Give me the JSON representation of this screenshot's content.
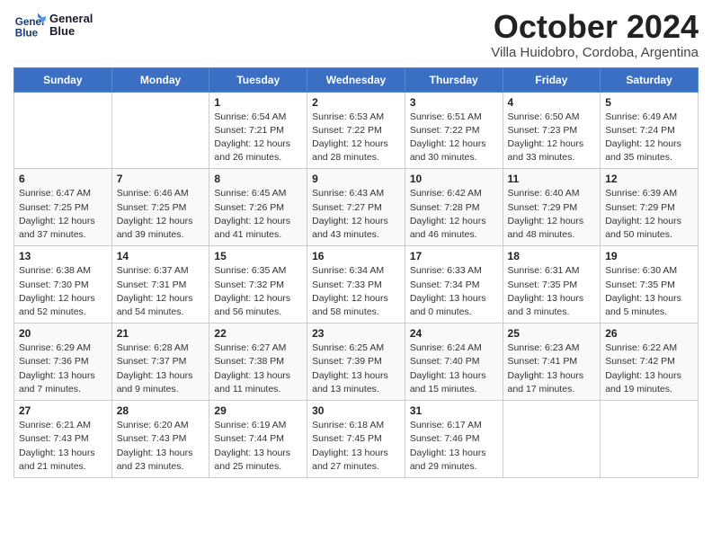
{
  "header": {
    "logo_line1": "General",
    "logo_line2": "Blue",
    "month": "October 2024",
    "location": "Villa Huidobro, Cordoba, Argentina"
  },
  "days_of_week": [
    "Sunday",
    "Monday",
    "Tuesday",
    "Wednesday",
    "Thursday",
    "Friday",
    "Saturday"
  ],
  "weeks": [
    [
      {
        "day": "",
        "content": ""
      },
      {
        "day": "",
        "content": ""
      },
      {
        "day": "1",
        "content": "Sunrise: 6:54 AM\nSunset: 7:21 PM\nDaylight: 12 hours and 26 minutes."
      },
      {
        "day": "2",
        "content": "Sunrise: 6:53 AM\nSunset: 7:22 PM\nDaylight: 12 hours and 28 minutes."
      },
      {
        "day": "3",
        "content": "Sunrise: 6:51 AM\nSunset: 7:22 PM\nDaylight: 12 hours and 30 minutes."
      },
      {
        "day": "4",
        "content": "Sunrise: 6:50 AM\nSunset: 7:23 PM\nDaylight: 12 hours and 33 minutes."
      },
      {
        "day": "5",
        "content": "Sunrise: 6:49 AM\nSunset: 7:24 PM\nDaylight: 12 hours and 35 minutes."
      }
    ],
    [
      {
        "day": "6",
        "content": "Sunrise: 6:47 AM\nSunset: 7:25 PM\nDaylight: 12 hours and 37 minutes."
      },
      {
        "day": "7",
        "content": "Sunrise: 6:46 AM\nSunset: 7:25 PM\nDaylight: 12 hours and 39 minutes."
      },
      {
        "day": "8",
        "content": "Sunrise: 6:45 AM\nSunset: 7:26 PM\nDaylight: 12 hours and 41 minutes."
      },
      {
        "day": "9",
        "content": "Sunrise: 6:43 AM\nSunset: 7:27 PM\nDaylight: 12 hours and 43 minutes."
      },
      {
        "day": "10",
        "content": "Sunrise: 6:42 AM\nSunset: 7:28 PM\nDaylight: 12 hours and 46 minutes."
      },
      {
        "day": "11",
        "content": "Sunrise: 6:40 AM\nSunset: 7:29 PM\nDaylight: 12 hours and 48 minutes."
      },
      {
        "day": "12",
        "content": "Sunrise: 6:39 AM\nSunset: 7:29 PM\nDaylight: 12 hours and 50 minutes."
      }
    ],
    [
      {
        "day": "13",
        "content": "Sunrise: 6:38 AM\nSunset: 7:30 PM\nDaylight: 12 hours and 52 minutes."
      },
      {
        "day": "14",
        "content": "Sunrise: 6:37 AM\nSunset: 7:31 PM\nDaylight: 12 hours and 54 minutes."
      },
      {
        "day": "15",
        "content": "Sunrise: 6:35 AM\nSunset: 7:32 PM\nDaylight: 12 hours and 56 minutes."
      },
      {
        "day": "16",
        "content": "Sunrise: 6:34 AM\nSunset: 7:33 PM\nDaylight: 12 hours and 58 minutes."
      },
      {
        "day": "17",
        "content": "Sunrise: 6:33 AM\nSunset: 7:34 PM\nDaylight: 13 hours and 0 minutes."
      },
      {
        "day": "18",
        "content": "Sunrise: 6:31 AM\nSunset: 7:35 PM\nDaylight: 13 hours and 3 minutes."
      },
      {
        "day": "19",
        "content": "Sunrise: 6:30 AM\nSunset: 7:35 PM\nDaylight: 13 hours and 5 minutes."
      }
    ],
    [
      {
        "day": "20",
        "content": "Sunrise: 6:29 AM\nSunset: 7:36 PM\nDaylight: 13 hours and 7 minutes."
      },
      {
        "day": "21",
        "content": "Sunrise: 6:28 AM\nSunset: 7:37 PM\nDaylight: 13 hours and 9 minutes."
      },
      {
        "day": "22",
        "content": "Sunrise: 6:27 AM\nSunset: 7:38 PM\nDaylight: 13 hours and 11 minutes."
      },
      {
        "day": "23",
        "content": "Sunrise: 6:25 AM\nSunset: 7:39 PM\nDaylight: 13 hours and 13 minutes."
      },
      {
        "day": "24",
        "content": "Sunrise: 6:24 AM\nSunset: 7:40 PM\nDaylight: 13 hours and 15 minutes."
      },
      {
        "day": "25",
        "content": "Sunrise: 6:23 AM\nSunset: 7:41 PM\nDaylight: 13 hours and 17 minutes."
      },
      {
        "day": "26",
        "content": "Sunrise: 6:22 AM\nSunset: 7:42 PM\nDaylight: 13 hours and 19 minutes."
      }
    ],
    [
      {
        "day": "27",
        "content": "Sunrise: 6:21 AM\nSunset: 7:43 PM\nDaylight: 13 hours and 21 minutes."
      },
      {
        "day": "28",
        "content": "Sunrise: 6:20 AM\nSunset: 7:43 PM\nDaylight: 13 hours and 23 minutes."
      },
      {
        "day": "29",
        "content": "Sunrise: 6:19 AM\nSunset: 7:44 PM\nDaylight: 13 hours and 25 minutes."
      },
      {
        "day": "30",
        "content": "Sunrise: 6:18 AM\nSunset: 7:45 PM\nDaylight: 13 hours and 27 minutes."
      },
      {
        "day": "31",
        "content": "Sunrise: 6:17 AM\nSunset: 7:46 PM\nDaylight: 13 hours and 29 minutes."
      },
      {
        "day": "",
        "content": ""
      },
      {
        "day": "",
        "content": ""
      }
    ]
  ]
}
